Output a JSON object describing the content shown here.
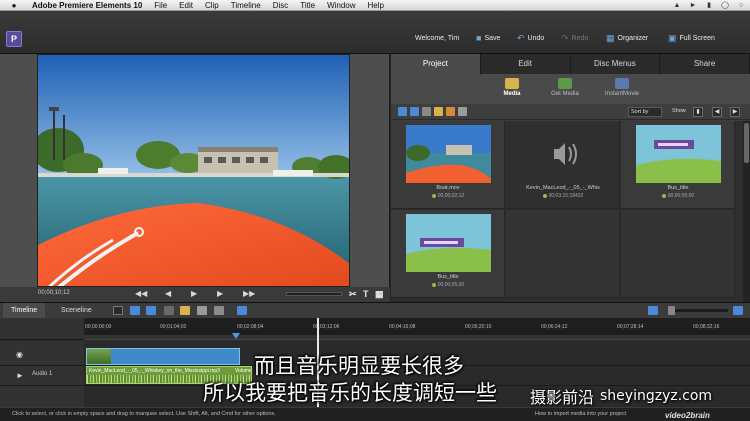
{
  "menubar": {
    "app_name": "Adobe Premiere Elements 10",
    "items": [
      "File",
      "Edit",
      "Clip",
      "Timeline",
      "Disc",
      "Title",
      "Window",
      "Help"
    ]
  },
  "header": {
    "welcome": "Welcome, Tim",
    "save": "Save",
    "undo": "Undo",
    "redo": "Redo",
    "organizer": "Organizer",
    "fullscreen": "Full Screen"
  },
  "monitor": {
    "current_time": "00;00;10;12"
  },
  "panel": {
    "tabs": [
      "Project",
      "Edit",
      "Disc Menus",
      "Share"
    ],
    "active_tab": "Project",
    "subtabs": [
      "Media",
      "Get Media",
      "InstantMovie"
    ],
    "active_subtab": "Media",
    "sort_by": "Sort by",
    "show": "Show",
    "clips": [
      {
        "name": "Boat.mov",
        "duration": "00;00;02;12"
      },
      {
        "name": "Kevin_MacLeod_-_05_-_Whis",
        "duration": "00;03;15;18432"
      },
      {
        "name": "Bus_title",
        "duration": "00;00;05;00"
      },
      {
        "name": "Bus_title",
        "duration": "00;00;05;00"
      }
    ]
  },
  "timeline": {
    "tabs": [
      "Timeline",
      "Sceneline"
    ],
    "active_tab": "Timeline",
    "ruler": [
      "00;00;00;00",
      "00;01;04;02",
      "00;02;08;04",
      "00;03;12;06",
      "00;04;16;08",
      "00;05;20;10",
      "00;06;24;12",
      "00;07;28;14",
      "00;08;32;16"
    ],
    "audio_track_label": "Audio 1",
    "audio_clip_name": "Kevin_MacLeod_-_05_-_Whiskey_on_the_Mississippi.mp3",
    "audio_clip_suffix": "Volume"
  },
  "status": {
    "left": "Click to select, or click in empty space and drag to marquee select. Use Shift, Alt, and Cmd for other options.",
    "right": "How to import media into your project",
    "brand": "video2brain"
  },
  "subtitles": {
    "line1": "而且音乐明显要长很多",
    "line2": "所以我要把音乐的长度调短一些",
    "watermark_cn": "摄影前沿",
    "watermark_url": "sheyingzyz.com"
  },
  "colors": {
    "accent_blue": "#4a9be8",
    "audio_clip_green": "#6f9c3a",
    "video_clip_blue": "#3f8bc9",
    "active_tab": "#4a4a4a"
  }
}
